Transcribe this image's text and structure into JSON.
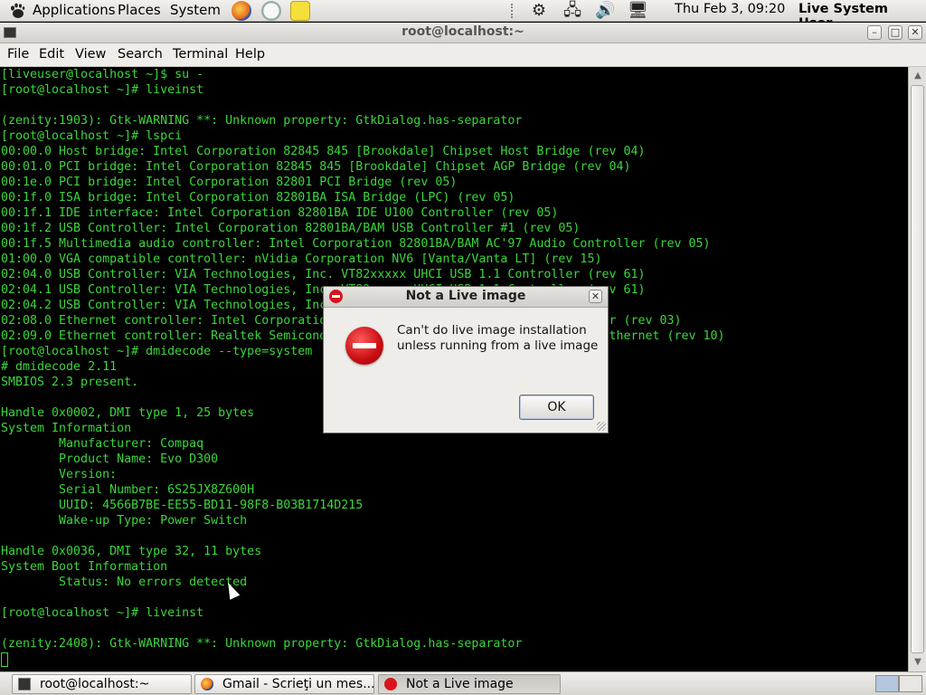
{
  "top_panel": {
    "menus": [
      "Applications",
      "Places",
      "System"
    ],
    "clock": "Thu Feb  3, 09:20",
    "user": "Live System User"
  },
  "window": {
    "title": "root@localhost:~",
    "menu": [
      "File",
      "Edit",
      "View",
      "Search",
      "Terminal",
      "Help"
    ]
  },
  "terminal": {
    "lines": [
      "[liveuser@localhost ~]$ su -",
      "[root@localhost ~]# liveinst",
      "",
      "(zenity:1903): Gtk-WARNING **: Unknown property: GtkDialog.has-separator",
      "[root@localhost ~]# lspci",
      "00:00.0 Host bridge: Intel Corporation 82845 845 [Brookdale] Chipset Host Bridge (rev 04)",
      "00:01.0 PCI bridge: Intel Corporation 82845 845 [Brookdale] Chipset AGP Bridge (rev 04)",
      "00:1e.0 PCI bridge: Intel Corporation 82801 PCI Bridge (rev 05)",
      "00:1f.0 ISA bridge: Intel Corporation 82801BA ISA Bridge (LPC) (rev 05)",
      "00:1f.1 IDE interface: Intel Corporation 82801BA IDE U100 Controller (rev 05)",
      "00:1f.2 USB Controller: Intel Corporation 82801BA/BAM USB Controller #1 (rev 05)",
      "00:1f.5 Multimedia audio controller: Intel Corporation 82801BA/BAM AC'97 Audio Controller (rev 05)",
      "01:00.0 VGA compatible controller: nVidia Corporation NV6 [Vanta/Vanta LT] (rev 15)",
      "02:04.0 USB Controller: VIA Technologies, Inc. VT82xxxxx UHCI USB 1.1 Controller (rev 61)",
      "02:04.1 USB Controller: VIA Technologies, Inc. VT82xxxxx UHCI USB 1.1 Controller (rev 61)",
      "02:04.2 USB Controller: VIA Technologies, Inc. USB 2.0 (rev 63)",
      "02:08.0 Ethernet controller: Intel Corporation 82801BA/BAM/CA/CAM Ethernet Controller (rev 03)",
      "02:09.0 Ethernet controller: Realtek Semiconductor Co., Ltd. RTL-8139/8139C/8139C+ Ethernet (rev 10)",
      "[root@localhost ~]# dmidecode --type=system",
      "# dmidecode 2.11",
      "SMBIOS 2.3 present.",
      "",
      "Handle 0x0002, DMI type 1, 25 bytes",
      "System Information",
      "        Manufacturer: Compaq",
      "        Product Name: Evo D300",
      "        Version:",
      "        Serial Number: 6S25JX8Z600H",
      "        UUID: 4566B7BE-EE55-BD11-98F8-B03B1714D215",
      "        Wake-up Type: Power Switch",
      "",
      "Handle 0x0036, DMI type 32, 11 bytes",
      "System Boot Information",
      "        Status: No errors detected",
      "",
      "[root@localhost ~]# liveinst",
      "",
      "(zenity:2408): Gtk-WARNING **: Unknown property: GtkDialog.has-separator"
    ]
  },
  "dialog": {
    "title": "Not a Live image",
    "message_line1": "Can't do live image installation",
    "message_line2": "unless running from a live image",
    "ok_label": "OK"
  },
  "taskbar": {
    "tasks": [
      "root@localhost:~",
      "Gmail - Scrieţi un mes...",
      "Not a Live image"
    ]
  },
  "icons": {
    "panel": [
      "gnome-foot-icon",
      "firefox-icon",
      "mail-icon",
      "notes-icon",
      "settings-gear-icon",
      "network-icon",
      "volume-icon",
      "display-icon"
    ]
  }
}
